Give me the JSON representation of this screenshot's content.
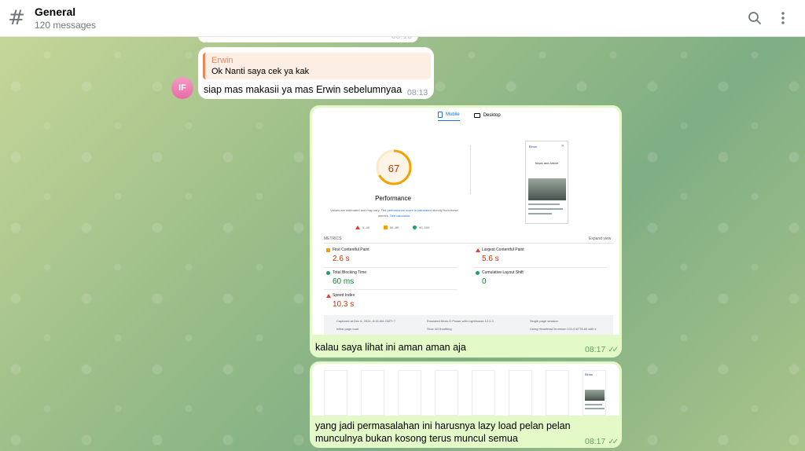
{
  "header": {
    "channel_title": "General",
    "message_count": "120 messages",
    "icons": {
      "channel": "hash-icon",
      "search": "search-icon",
      "menu": "more-vertical-icon"
    }
  },
  "messages": [
    {
      "id": "m1",
      "partial_time": "08:13"
    },
    {
      "id": "m2",
      "avatar_initials": "IF",
      "reply_to": {
        "author": "Erwin",
        "text": "Ok Nanti saya cek ya kak"
      },
      "text": "siap mas makasii ya mas Erwin sebelumnyaa",
      "time": "08:13"
    },
    {
      "id": "m3",
      "outgoing": true,
      "screenshot": {
        "tabs": [
          "Mobile",
          "Desktop"
        ],
        "score": "67",
        "score_label": "Performance",
        "note_pre": "Values are estimated and may vary. The",
        "note_link": "performance score is calculated",
        "note_post": "directly from these metrics.",
        "note_link2": "See calculator.",
        "legend": [
          "0–49",
          "50–89",
          "90–100"
        ],
        "phone_brand": "Binus",
        "phone_heading": "News and Article",
        "metrics_title": "METRICS",
        "expand": "Expand view",
        "metrics": [
          {
            "name": "First Contentful Paint",
            "value": "2.6 s",
            "status": "average"
          },
          {
            "name": "Largest Contentful Paint",
            "value": "5.6 s",
            "status": "fail"
          },
          {
            "name": "Total Blocking Time",
            "value": "60 ms",
            "status": "pass"
          },
          {
            "name": "Cumulative Layout Shift",
            "value": "0",
            "status": "pass"
          },
          {
            "name": "Speed Index",
            "value": "10.3 s",
            "status": "fail"
          }
        ],
        "footer": [
          "Captured at Dec 6, 2024, 8:15 AM GMT+7",
          "Emulated Moto G Power with Lighthouse 12.2.3",
          "Single page session",
          "Initial page load",
          "Slow 4G throttling",
          "Using HeadlessChromium 131.0.6778.69 with lr"
        ]
      },
      "text": "kalau saya lihat ini aman aman aja",
      "time": "08:17"
    },
    {
      "id": "m4",
      "outgoing": true,
      "filmstrip_brand": "Binus",
      "text_line1": "yang jadi permasalahan ini harusnya lazy load pelan pelan",
      "text_line2": "munculnya bukan kosong terus muncul semua",
      "time": "08:17"
    }
  ],
  "colors": {
    "outgoing_bubble": "#e3f9c8",
    "incoming_bubble": "#ffffff",
    "reply_accent": "#e8865a",
    "score_color": "#c33300",
    "link_blue": "#1a73e8"
  }
}
